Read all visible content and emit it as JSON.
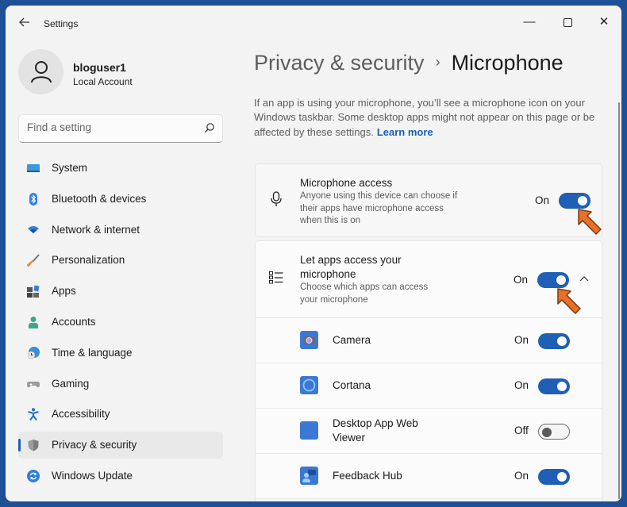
{
  "window": {
    "title": "Settings",
    "controls": {
      "minimize": "—",
      "maximize": "",
      "close": "✕"
    }
  },
  "user": {
    "name": "bloguser1",
    "account_type": "Local Account"
  },
  "search": {
    "placeholder": "Find a setting",
    "value": ""
  },
  "sidebar": {
    "items": [
      {
        "label": "System",
        "icon": "system-icon",
        "active": false
      },
      {
        "label": "Bluetooth & devices",
        "icon": "bluetooth-icon",
        "active": false
      },
      {
        "label": "Network & internet",
        "icon": "wifi-icon",
        "active": false
      },
      {
        "label": "Personalization",
        "icon": "brush-icon",
        "active": false
      },
      {
        "label": "Apps",
        "icon": "apps-icon",
        "active": false
      },
      {
        "label": "Accounts",
        "icon": "person-icon",
        "active": false
      },
      {
        "label": "Time & language",
        "icon": "globe-clock-icon",
        "active": false
      },
      {
        "label": "Gaming",
        "icon": "gamepad-icon",
        "active": false
      },
      {
        "label": "Accessibility",
        "icon": "accessibility-icon",
        "active": false
      },
      {
        "label": "Privacy & security",
        "icon": "shield-icon",
        "active": true
      },
      {
        "label": "Windows Update",
        "icon": "update-icon",
        "active": false
      }
    ]
  },
  "header": {
    "parent": "Privacy & security",
    "separator": "›",
    "current": "Microphone"
  },
  "description": {
    "text": "If an app is using your microphone, you’ll see a microphone icon on your Windows taskbar. Some desktop apps might not appear on this page or be affected by these settings.",
    "link": "Learn more"
  },
  "settings": {
    "microphone_access": {
      "title": "Microphone access",
      "subtitle": "Anyone using this device can choose if their apps have microphone access when this is on",
      "state_label": "On",
      "enabled": true
    },
    "let_apps_access": {
      "title": "Let apps access your microphone",
      "subtitle": "Choose which apps can access your microphone",
      "state_label": "On",
      "enabled": true,
      "expanded": true
    },
    "apps": [
      {
        "name": "Camera",
        "state_label": "On",
        "enabled": true,
        "icon": "camera-app-icon"
      },
      {
        "name": "Cortana",
        "state_label": "On",
        "enabled": true,
        "icon": "cortana-app-icon"
      },
      {
        "name": "Desktop App Web Viewer",
        "state_label": "Off",
        "enabled": false,
        "icon": "web-viewer-app-icon"
      },
      {
        "name": "Feedback Hub",
        "state_label": "On",
        "enabled": true,
        "icon": "feedback-hub-app-icon"
      }
    ]
  },
  "colors": {
    "accent": "#1f5fb5",
    "annotation_arrow": "#e8702a",
    "desktop_background": "#1f4f94"
  }
}
